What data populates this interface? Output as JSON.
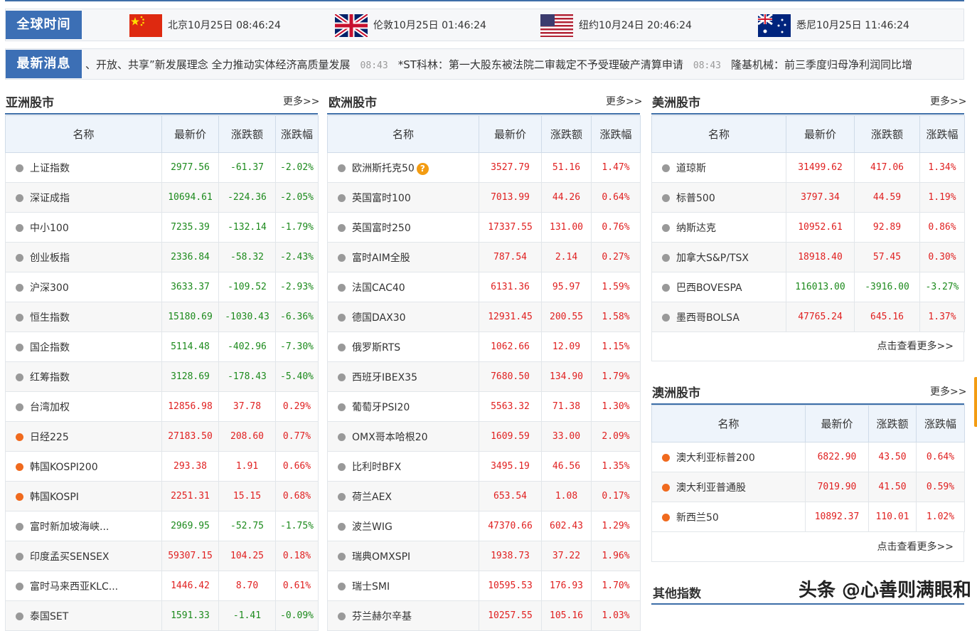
{
  "time_bar": {
    "label": "全球时间",
    "cities": [
      {
        "text": "北京10月25日 08:46:24",
        "flag": "china-flag-icon"
      },
      {
        "text": "伦敦10月25日 01:46:24",
        "flag": "uk-flag-icon"
      },
      {
        "text": "纽约10月24日 20:46:24",
        "flag": "usa-flag-icon"
      },
      {
        "text": "悉尼10月25日 11:46:24",
        "flag": "australia-flag-icon"
      }
    ]
  },
  "news_bar": {
    "label": "最新消息",
    "items": [
      {
        "text": "、开放、共享”新发展理念 全力推动实体经济高质量发展",
        "time": "08:43"
      },
      {
        "text": "*ST科林：第一大股东被法院二审裁定不予受理破产清算申请",
        "time": "08:43"
      },
      {
        "text": "隆基机械：前三季度归母净利润同比增",
        "time": ""
      }
    ]
  },
  "columns": [
    "名称",
    "最新价",
    "涨跌额",
    "涨跌幅"
  ],
  "more_label": "更多>>",
  "see_more_label": "点击查看更多>>",
  "asia": {
    "title": "亚洲股市",
    "rows": [
      {
        "name": "上证指数",
        "price": "2977.56",
        "change": "-61.37",
        "pct": "-2.02%",
        "open": false
      },
      {
        "name": "深证成指",
        "price": "10694.61",
        "change": "-224.36",
        "pct": "-2.05%",
        "open": false
      },
      {
        "name": "中小100",
        "price": "7235.39",
        "change": "-132.14",
        "pct": "-1.79%",
        "open": false
      },
      {
        "name": "创业板指",
        "price": "2336.84",
        "change": "-58.32",
        "pct": "-2.43%",
        "open": false
      },
      {
        "name": "沪深300",
        "price": "3633.37",
        "change": "-109.52",
        "pct": "-2.93%",
        "open": false
      },
      {
        "name": "恒生指数",
        "price": "15180.69",
        "change": "-1030.43",
        "pct": "-6.36%",
        "open": false
      },
      {
        "name": "国企指数",
        "price": "5114.48",
        "change": "-402.96",
        "pct": "-7.30%",
        "open": false
      },
      {
        "name": "红筹指数",
        "price": "3128.69",
        "change": "-178.43",
        "pct": "-5.40%",
        "open": false
      },
      {
        "name": "台湾加权",
        "price": "12856.98",
        "change": "37.78",
        "pct": "0.29%",
        "open": false
      },
      {
        "name": "日经225",
        "price": "27183.50",
        "change": "208.60",
        "pct": "0.77%",
        "open": true
      },
      {
        "name": "韩国KOSPI200",
        "price": "293.38",
        "change": "1.91",
        "pct": "0.66%",
        "open": true
      },
      {
        "name": "韩国KOSPI",
        "price": "2251.31",
        "change": "15.15",
        "pct": "0.68%",
        "open": true
      },
      {
        "name": "富时新加坡海峡...",
        "price": "2969.95",
        "change": "-52.75",
        "pct": "-1.75%",
        "open": false
      },
      {
        "name": "印度孟买SENSEX",
        "price": "59307.15",
        "change": "104.25",
        "pct": "0.18%",
        "open": false
      },
      {
        "name": "富时马来西亚KLC...",
        "price": "1446.42",
        "change": "8.70",
        "pct": "0.61%",
        "open": false
      },
      {
        "name": "泰国SET",
        "price": "1591.33",
        "change": "-1.41",
        "pct": "-0.09%",
        "open": false
      }
    ]
  },
  "europe": {
    "title": "欧洲股市",
    "rows": [
      {
        "name": "欧洲斯托克50",
        "price": "3527.79",
        "change": "51.16",
        "pct": "1.47%",
        "open": false,
        "help": true
      },
      {
        "name": "英国富时100",
        "price": "7013.99",
        "change": "44.26",
        "pct": "0.64%",
        "open": false
      },
      {
        "name": "英国富时250",
        "price": "17337.55",
        "change": "131.00",
        "pct": "0.76%",
        "open": false
      },
      {
        "name": "富时AIM全股",
        "price": "787.54",
        "change": "2.14",
        "pct": "0.27%",
        "open": false
      },
      {
        "name": "法国CAC40",
        "price": "6131.36",
        "change": "95.97",
        "pct": "1.59%",
        "open": false
      },
      {
        "name": "德国DAX30",
        "price": "12931.45",
        "change": "200.55",
        "pct": "1.58%",
        "open": false
      },
      {
        "name": "俄罗斯RTS",
        "price": "1062.66",
        "change": "12.09",
        "pct": "1.15%",
        "open": false
      },
      {
        "name": "西班牙IBEX35",
        "price": "7680.50",
        "change": "134.90",
        "pct": "1.79%",
        "open": false
      },
      {
        "name": "葡萄牙PSI20",
        "price": "5563.32",
        "change": "71.38",
        "pct": "1.30%",
        "open": false
      },
      {
        "name": "OMX哥本哈根20",
        "price": "1609.59",
        "change": "33.00",
        "pct": "2.09%",
        "open": false
      },
      {
        "name": "比利时BFX",
        "price": "3495.19",
        "change": "46.56",
        "pct": "1.35%",
        "open": false
      },
      {
        "name": "荷兰AEX",
        "price": "653.54",
        "change": "1.08",
        "pct": "0.17%",
        "open": false
      },
      {
        "name": "波兰WIG",
        "price": "47370.66",
        "change": "602.43",
        "pct": "1.29%",
        "open": false
      },
      {
        "name": "瑞典OMXSPI",
        "price": "1938.73",
        "change": "37.22",
        "pct": "1.96%",
        "open": false
      },
      {
        "name": "瑞士SMI",
        "price": "10595.53",
        "change": "176.93",
        "pct": "1.70%",
        "open": false
      },
      {
        "name": "芬兰赫尔辛基",
        "price": "10257.55",
        "change": "105.16",
        "pct": "1.03%",
        "open": false
      }
    ]
  },
  "america": {
    "title": "美洲股市",
    "rows": [
      {
        "name": "道琼斯",
        "price": "31499.62",
        "change": "417.06",
        "pct": "1.34%",
        "open": false
      },
      {
        "name": "标普500",
        "price": "3797.34",
        "change": "44.59",
        "pct": "1.19%",
        "open": false
      },
      {
        "name": "纳斯达克",
        "price": "10952.61",
        "change": "92.89",
        "pct": "0.86%",
        "open": false
      },
      {
        "name": "加拿大S&P/TSX",
        "price": "18918.40",
        "change": "57.45",
        "pct": "0.30%",
        "open": false
      },
      {
        "name": "巴西BOVESPA",
        "price": "116013.00",
        "change": "-3916.00",
        "pct": "-3.27%",
        "open": false
      },
      {
        "name": "墨西哥BOLSA",
        "price": "47765.24",
        "change": "645.16",
        "pct": "1.37%",
        "open": false
      }
    ]
  },
  "oceania": {
    "title": "澳洲股市",
    "rows": [
      {
        "name": "澳大利亚标普200",
        "price": "6822.90",
        "change": "43.50",
        "pct": "0.64%",
        "open": true
      },
      {
        "name": "澳大利亚普通股",
        "price": "7019.90",
        "change": "41.50",
        "pct": "0.59%",
        "open": true
      },
      {
        "name": "新西兰50",
        "price": "10892.37",
        "change": "110.01",
        "pct": "1.02%",
        "open": true
      }
    ]
  },
  "other": {
    "title": "其他指数"
  },
  "watermark": "头条 @心善则满眼和",
  "colors": {
    "up": "#e02020",
    "down": "#1c8a1c",
    "accent": "#3c6fb5",
    "open_dot": "#f06a1e",
    "closed_dot": "#999999"
  }
}
